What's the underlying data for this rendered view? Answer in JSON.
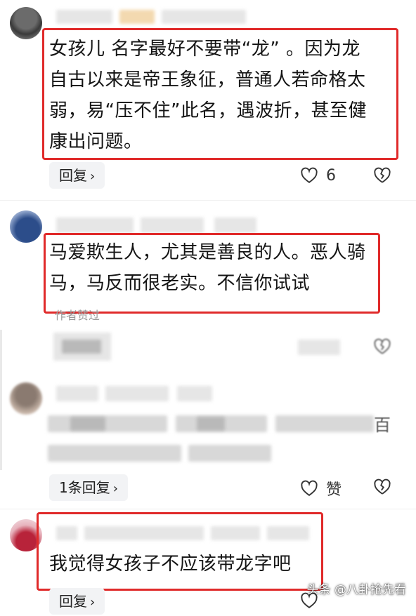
{
  "comments": [
    {
      "text_lines": [
        "女孩儿 名字最好不要带“龙” 。因为龙",
        "自古以来是帝王象征，普通人若命格太",
        "弱，易“压不住”此名，遇波折，甚至健",
        "康出问题。"
      ],
      "reply_label": "回复",
      "like_count": "6"
    },
    {
      "text_lines": [
        "马爱欺生人，尤其是善良的人。恶人骑",
        "马，马反而很老实。不信你试试"
      ],
      "author_liked": "作者赞过"
    },
    {
      "reply_label": "1条回复",
      "like_label": "赞"
    },
    {
      "text_lines": [
        "我觉得女孩子不应该带龙字吧"
      ],
      "reply_label": "回复"
    }
  ],
  "blurred_trailing_char": "百",
  "watermark": "头条 @八卦抢先看",
  "icons": [
    "chevron-right-icon",
    "heart-outline-icon",
    "broken-heart-icon"
  ]
}
